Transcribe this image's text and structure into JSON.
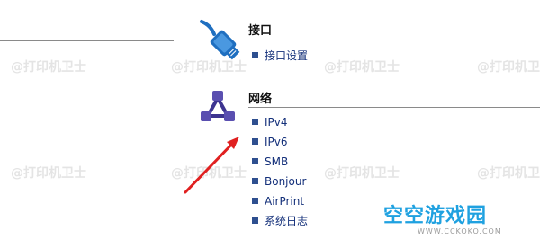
{
  "sections": [
    {
      "title": "接口",
      "icon": "cable-connector-icon",
      "items": [
        "接口设置"
      ]
    },
    {
      "title": "网络",
      "icon": "network-icon",
      "items": [
        "IPv4",
        "IPv6",
        "SMB",
        "Bonjour",
        "AirPrint",
        "系统日志"
      ]
    }
  ],
  "watermark": "@打印机卫士",
  "logo": {
    "text": "空空游戏园",
    "sub": "WWW.CCKOKO.COM"
  },
  "colors": {
    "link": "#14307a",
    "bullet": "#2e4f8f",
    "icon_blue": "#1f6fc0",
    "network_purple": "#5a4fb0",
    "arrow": "#e02020",
    "logo": "#1fa1e0"
  }
}
